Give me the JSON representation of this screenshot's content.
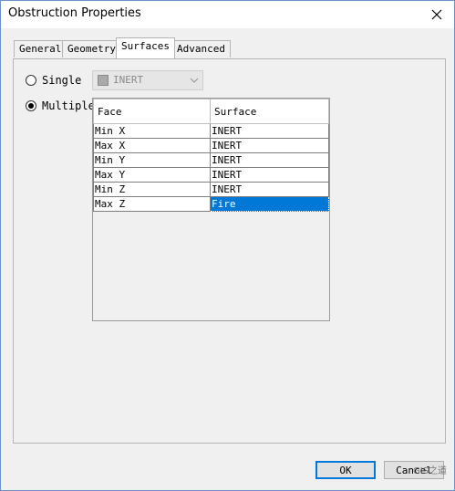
{
  "window": {
    "title": "Obstruction Properties"
  },
  "tabs": [
    "General",
    "Geometry",
    "Surfaces",
    "Advanced"
  ],
  "surfaces": {
    "single_label": "Single",
    "multiple_label": "Multiple",
    "selected_mode": "Multiple",
    "single_combo_value": "INERT",
    "grid": {
      "headers": [
        "Face",
        "Surface"
      ],
      "rows": [
        {
          "face": "Min X",
          "surface": "INERT"
        },
        {
          "face": "Max X",
          "surface": "INERT"
        },
        {
          "face": "Min Y",
          "surface": "INERT"
        },
        {
          "face": "Max Y",
          "surface": "INERT"
        },
        {
          "face": "Min Z",
          "surface": "INERT"
        },
        {
          "face": "Max Z",
          "surface": "Fire"
        }
      ]
    }
  },
  "buttons": {
    "ok": "OK",
    "cancel": "Cancel"
  },
  "watermark": "GIS之道",
  "icons": {
    "close": "close-icon",
    "dropdown": "chevron-down-icon"
  }
}
